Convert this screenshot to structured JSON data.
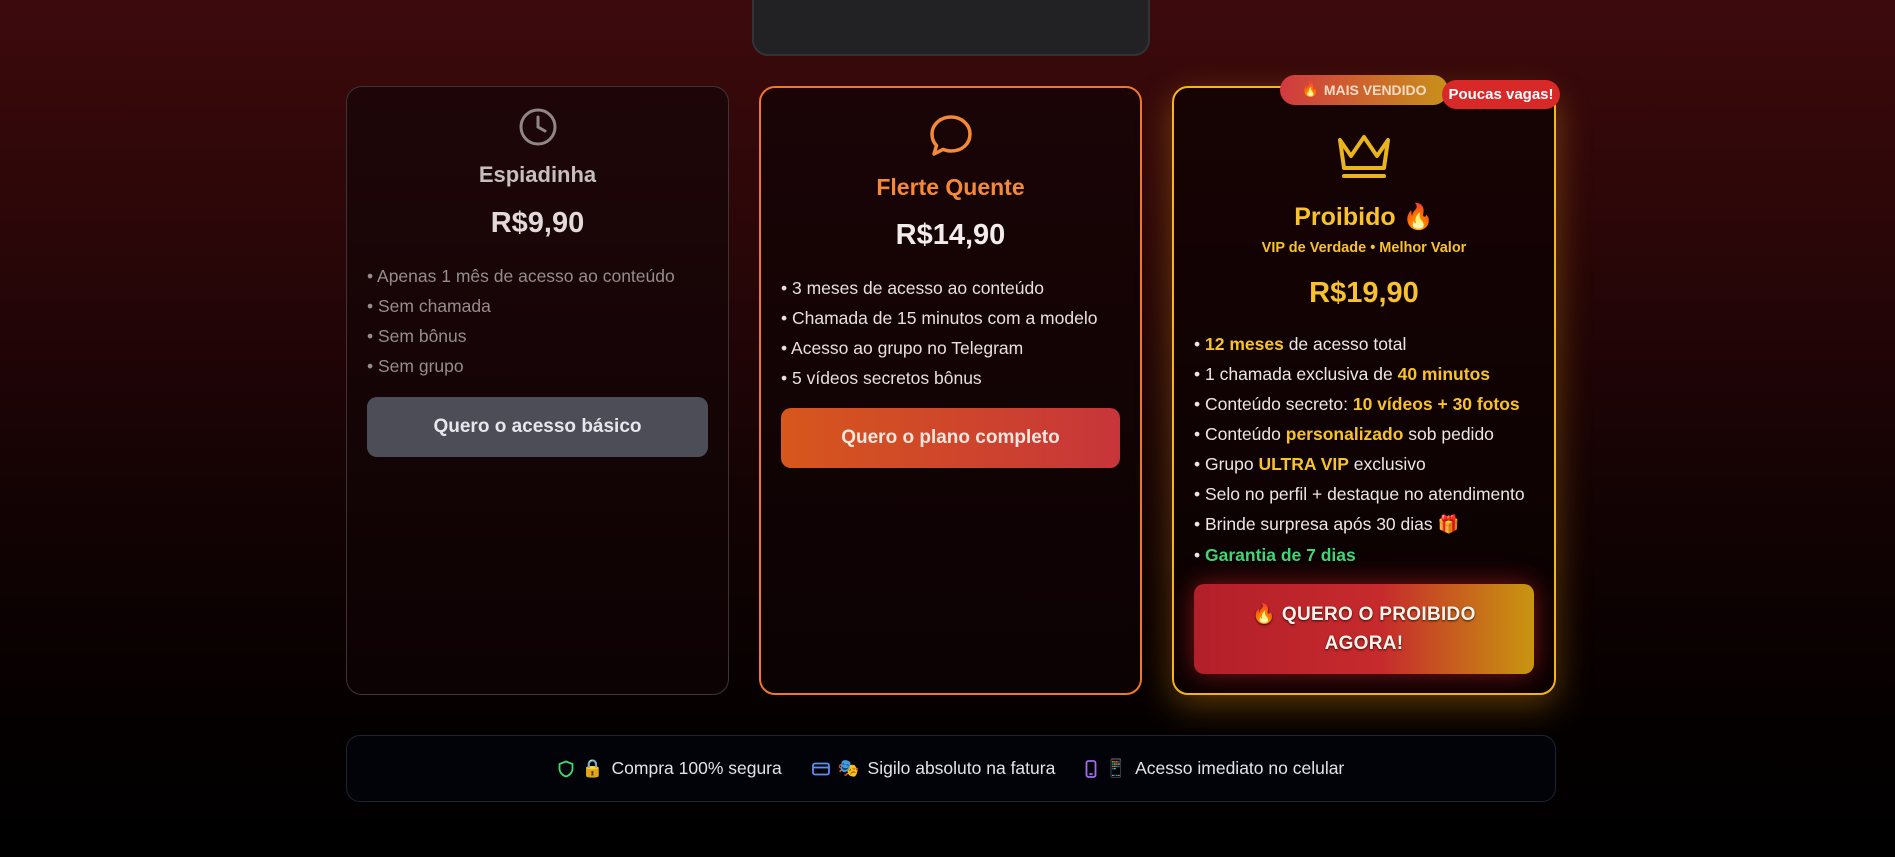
{
  "plans": [
    {
      "icon": "clock-icon",
      "name": "Espiadinha",
      "price": "R$9,90",
      "features": [
        "• Apenas 1 mês de acesso ao conteúdo",
        "• Sem chamada",
        "• Sem bônus",
        "• Sem grupo"
      ],
      "button_label": "Quero o acesso básico"
    },
    {
      "icon": "chat-bubble-icon",
      "name": "Flerte Quente",
      "price": "R$14,90",
      "features": [
        "• 3 meses de acesso ao conteúdo",
        "• Chamada de 15 minutos com a modelo",
        "• Acesso ao grupo no Telegram",
        "• 5 vídeos secretos bônus"
      ],
      "button_label": "Quero o plano completo"
    },
    {
      "icon": "crown-icon",
      "name": "Proibido",
      "name_emoji": "🔥",
      "subtitle": "VIP de Verdade • Melhor Valor",
      "price": "R$19,90",
      "badge_best_seller": "MAIS VENDIDO",
      "badge_best_seller_emoji": "🔥",
      "badge_few_spots": "Poucas vagas!",
      "features": [
        {
          "pre": "• ",
          "hl": "12 meses",
          "post": " de acesso total"
        },
        {
          "pre": "• 1 chamada exclusiva de ",
          "hl": "40 minutos",
          "post": ""
        },
        {
          "pre": "• Conteúdo secreto: ",
          "hl": "10 vídeos + 30 fotos",
          "post": ""
        },
        {
          "pre": "• Conteúdo ",
          "hl": "personalizado",
          "post": " sob pedido"
        },
        {
          "pre": "• Grupo ",
          "hl": "ULTRA VIP",
          "post": " exclusivo"
        },
        {
          "pre": "• Selo no perfil + destaque no atendimento",
          "hl": "",
          "post": ""
        },
        {
          "pre": "• Brinde surpresa após 30 dias ",
          "gift": "🎁"
        },
        {
          "pre": "• ",
          "green": "Garantia de 7 dias"
        }
      ],
      "button_emoji": "🔥",
      "button_label": "QUERO O PROIBIDO AGORA!"
    }
  ],
  "trust": [
    {
      "icon": "shield-icon",
      "emoji": "🔒",
      "label": "Compra 100% segura",
      "color": "#3ed773"
    },
    {
      "icon": "credit-card-icon",
      "emoji": "🎭",
      "label": "Sigilo absoluto na fatura",
      "color": "#5b8ff0"
    },
    {
      "icon": "smartphone-icon",
      "emoji": "📱",
      "label": "Acesso imediato no celular",
      "color": "#a66cf0"
    }
  ],
  "colors": {
    "gold": "#f7c22c",
    "orange": "#f48a38",
    "green": "#3ed773",
    "red_badge": "#d82828"
  }
}
